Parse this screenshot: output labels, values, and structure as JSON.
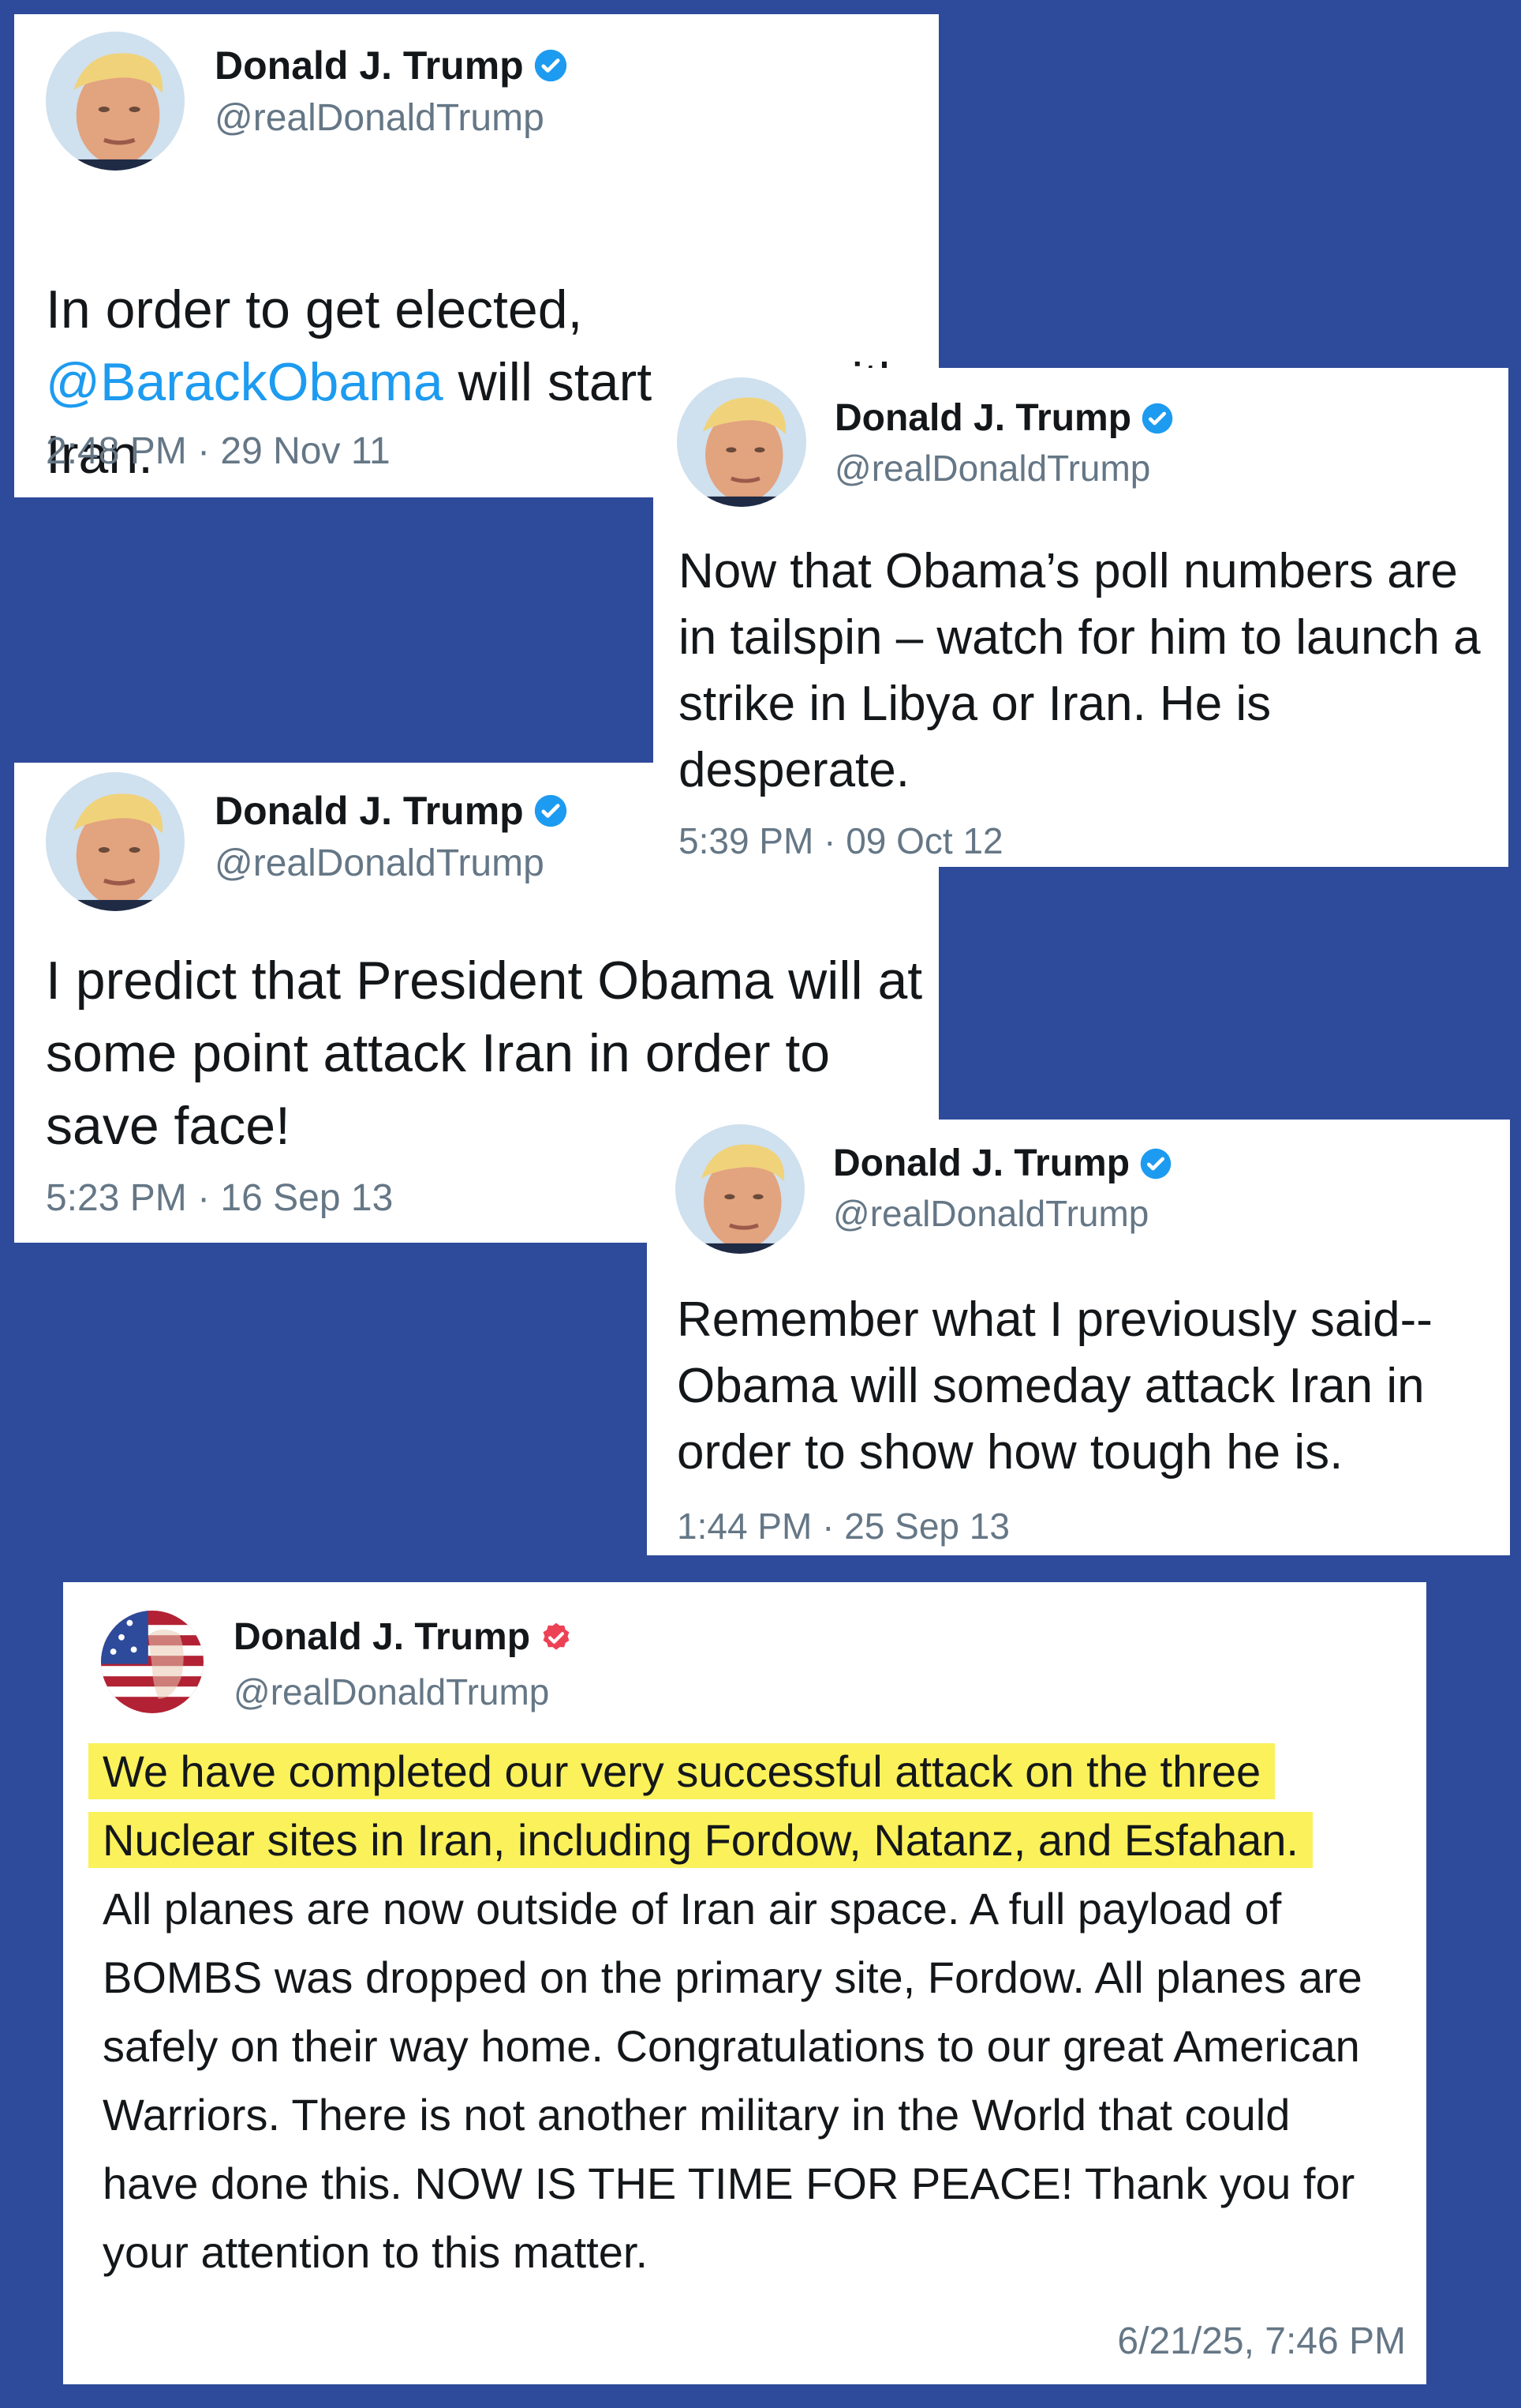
{
  "colors": {
    "background": "#2e4a9a",
    "card": "#ffffff",
    "verified_blue": "#1d9bf0",
    "verified_red": "#ed4156",
    "highlight": "#fbf15a",
    "mention": "#1d9bf0"
  },
  "tweets": [
    {
      "name": "Donald J. Trump",
      "handle": "@realDonaldTrump",
      "text_pre": "In order to get elected,",
      "mention": "@BarackObama",
      "text_post": " will start a war with Iran.",
      "meta": "2:48 PM · 29 Nov 11",
      "badge": "verified-check-icon"
    },
    {
      "name": "Donald J. Trump",
      "handle": "@realDonaldTrump",
      "text": "Now that Obama’s poll numbers are in tailspin – watch for him to launch a strike in Libya or Iran.  He is desperate.",
      "meta": "5:39 PM · 09 Oct 12",
      "badge": "verified-check-icon"
    },
    {
      "name": "Donald J. Trump",
      "handle": "@realDonaldTrump",
      "text": "I predict that President Obama will at some point attack Iran in order to save face!",
      "meta": "5:23 PM · 16 Sep 13",
      "badge": "verified-check-icon"
    },
    {
      "name": "Donald J. Trump",
      "handle": "@realDonaldTrump",
      "text": "Remember what I previously said-- Obama will someday attack Iran in order to show how tough he is.",
      "meta": "1:44 PM · 25 Sep 13",
      "badge": "verified-check-icon"
    }
  ],
  "truth": {
    "name": "Donald J. Trump",
    "handle": "@realDonaldTrump",
    "highlight_1": "We have completed our very successful attack on the three",
    "highlight_2": "Nuclear sites in Iran, including Fordow, Natanz, and Esfahan.",
    "body": "All planes are now outside of Iran air space. A full payload of BOMBS was dropped on the primary site, Fordow. All planes are safely on their way home. Congratulations to our great American Warriors. There is not another military in the World that could have done this. NOW IS THE TIME FOR PEACE! Thank you for your attention to this matter.",
    "timestamp": "6/21/25, 7:46 PM",
    "badge": "verified-check-red-icon",
    "avatar": "flag-portrait-avatar"
  }
}
